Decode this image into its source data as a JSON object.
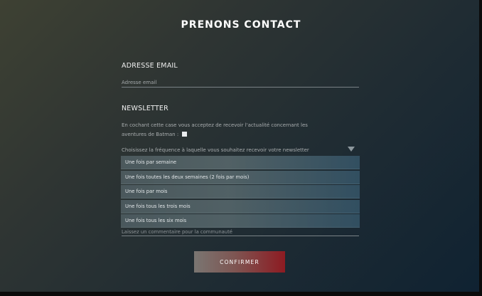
{
  "page": {
    "title": "PRENONS CONTACT"
  },
  "email": {
    "section_label": "ADRESSE EMAIL",
    "placeholder": "Adresse email"
  },
  "newsletter": {
    "section_label": "NEWSLETTER",
    "consent_line1": "En cochant cette case vous acceptez de recevoir l'actualité concernant les",
    "consent_line2": "aventures de Batman :",
    "checkbox_checked": false,
    "frequency_label": "Choisissez la fréquence à laquelle vous souhaitez recevoir votre newsletter",
    "options": [
      "Une fois par semaine",
      "Une fois toutes les deux semaines (2 fois par mois)",
      "Une fois par mois",
      "Une fois tous les trois mois",
      "Une fois tous les six mois"
    ]
  },
  "comment": {
    "placeholder": "Laissez un commentaire pour la communauté"
  },
  "confirm": {
    "label": "CONFIRMER"
  },
  "colors": {
    "button_gradient_start": "#7a7672",
    "button_gradient_end": "#8d1b22"
  }
}
